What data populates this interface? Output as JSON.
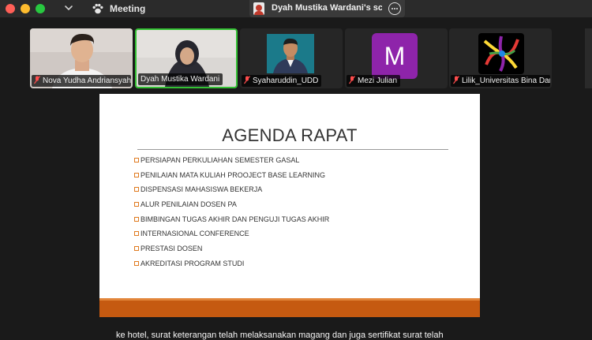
{
  "window": {
    "app_title": "Meeting",
    "share_tab_label": "Dyah Mustika Wardani's screen"
  },
  "participants": [
    {
      "name": "Nova Yudha Andriansyah",
      "muted": true,
      "active": false
    },
    {
      "name": "Dyah Mustika Wardani",
      "muted": false,
      "active": true
    },
    {
      "name": "Syaharuddin_UDD",
      "muted": true,
      "active": false
    },
    {
      "name": "Mezi Julian",
      "muted": true,
      "active": false,
      "avatar_letter": "M"
    },
    {
      "name": "Lilik_Universitas Bina Darma",
      "muted": true,
      "active": false
    }
  ],
  "slide": {
    "title": "AGENDA RAPAT",
    "items": [
      "PERSIAPAN PERKULIAHAN  SEMESTER GASAL",
      "PENILAIAN MATA KULIAH PROOJECT BASE LEARNING",
      "DISPENSASI MAHASISWA BEKERJA",
      "ALUR PENILAIAN DOSEN PA",
      "BIMBINGAN TUGAS AKHIR DAN PENGUJI TUGAS AKHIR",
      "INTERNASIONAL CONFERENCE",
      "PRESTASI DOSEN",
      "AKREDITASI PROGRAM STUDI"
    ]
  },
  "caption": "ke hotel, surat keterangan telah melaksanakan magang dan juga sertifikat surat telah",
  "colors": {
    "active_speaker": "#33c133",
    "slide_bar": "#c55a11",
    "bullet": "#e07a1f",
    "avatar_mezi": "#8e24aa"
  }
}
